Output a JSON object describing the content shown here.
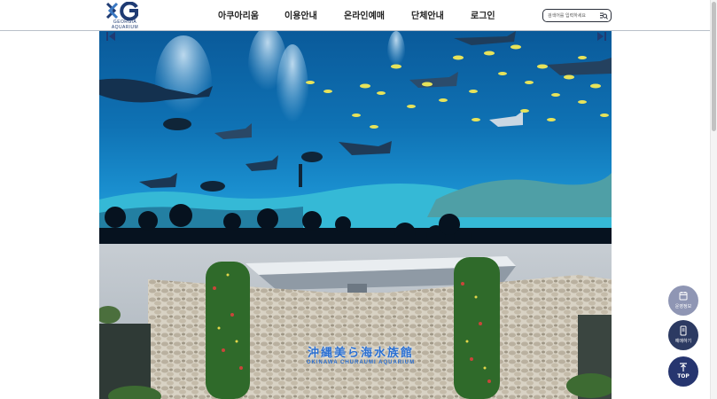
{
  "header": {
    "logo_letters": "XG",
    "logo_line1": "GEORGIA",
    "logo_line2": "AQUARIUM",
    "nav": [
      {
        "label": "아쿠아리움",
        "name": "nav-item-aquarium"
      },
      {
        "label": "이용안내",
        "name": "nav-item-info"
      },
      {
        "label": "온라인예매",
        "name": "nav-item-booking"
      },
      {
        "label": "단체안내",
        "name": "nav-item-group"
      },
      {
        "label": "로그인",
        "name": "nav-item-login"
      }
    ],
    "search_placeholder": "검색어를 입력하세요",
    "search_icon": "search-icon"
  },
  "banner": {
    "prev_icon": "prev-arrow-icon",
    "next_icon": "next-arrow-icon"
  },
  "photo2": {
    "sign_text": "沖縄美ら海水族館",
    "sign_sub": "OKINAWA CHURAUMI AQUARIUM"
  },
  "floating": {
    "info_label": "운영정보",
    "book_label": "예매하기",
    "top_label": "TOP"
  },
  "colors": {
    "brand": "#1f3b73",
    "fab_info": "#8f96b4",
    "fab_book": "#2c3a62",
    "fab_top": "#26356f"
  }
}
